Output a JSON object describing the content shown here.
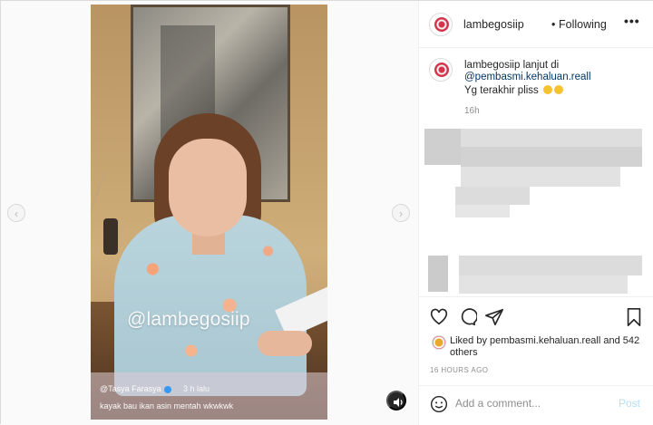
{
  "media": {
    "watermark": "@lambegosiip",
    "overlay_comment": {
      "name": "@Tasya Farasya",
      "time": "3 h lalu",
      "text": "kayak bau ikan asin mentah wkwkwk"
    }
  },
  "header": {
    "username": "lambegosiip",
    "separator": "•",
    "follow_status": "Following",
    "more_label": "•••"
  },
  "caption": {
    "username": "lambegosiip",
    "text_before_mention": "lanjut di",
    "mention": "@pembasmi.kehaluan.reall",
    "text_after": "Yg terakhir pliss",
    "time": "16h"
  },
  "icons": {
    "like": "heart-icon",
    "comment": "comment-icon",
    "share": "share-icon",
    "save": "bookmark-icon",
    "emoji": "smile-icon",
    "audio": "speaker-icon"
  },
  "likes": {
    "text": "Liked by pembasmi.kehaluan.reall and 542 others"
  },
  "post_time": "16 HOURS AGO",
  "comment_box": {
    "placeholder": "Add a comment...",
    "post_label": "Post"
  },
  "colors": {
    "link": "#00376b",
    "post_disabled": "#b2dffc",
    "muted": "#8e8e8e"
  }
}
